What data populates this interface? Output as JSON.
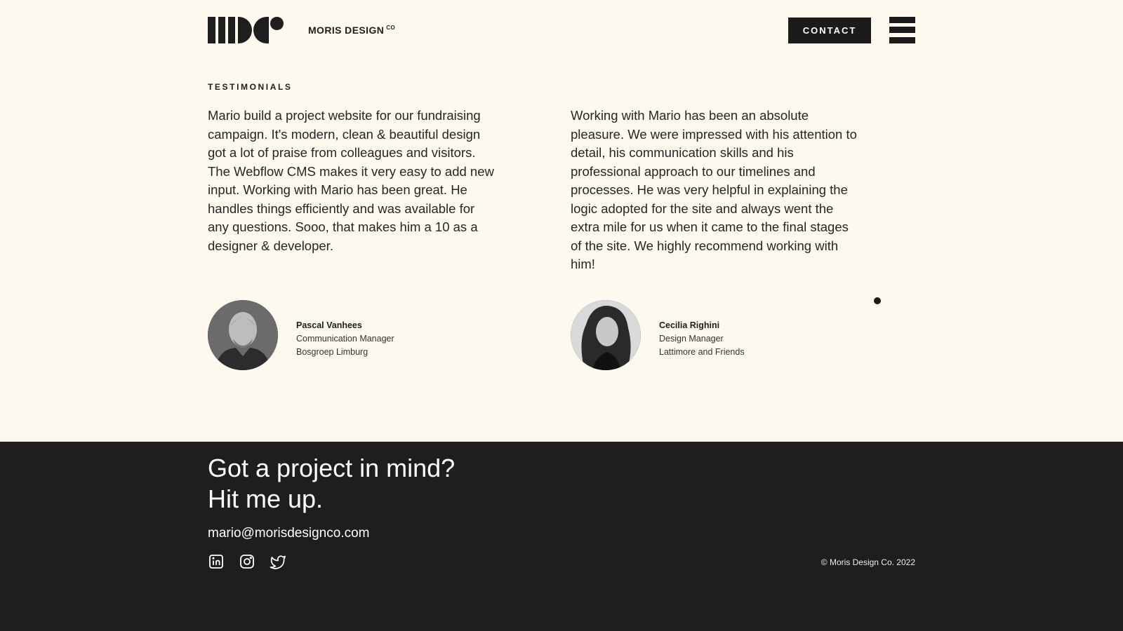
{
  "header": {
    "brand": "MORIS DESIGN",
    "brand_suffix": "CO",
    "contact_label": "CONTACT"
  },
  "testimonials": {
    "section_label": "TESTIMONIALS",
    "items": [
      {
        "quote": "Mario build a project website for our fundraising campaign. It's modern, clean & beautiful design got a lot of praise from colleagues and visitors. The Webflow CMS makes it very easy to add new input. Working with Mario has been great. He handles things efficiently and was available for any questions. Sooo, that makes him a 10 as a designer & developer.",
        "name": "Pascal Vanhees",
        "role": "Communication Manager",
        "company": "Bosgroep Limburg"
      },
      {
        "quote": "Working with Mario has been an absolute pleasure. We were impressed with his attention to detail, his communication skills and his professional approach to our timelines and processes. He was very helpful in explaining the logic adopted for the site and always went the extra mile for us when it came to the final stages of the site. We highly recommend working with him!",
        "name": "Cecilia Righini",
        "role": "Design Manager",
        "company": "Lattimore and Friends"
      }
    ]
  },
  "footer": {
    "cta_line1": "Got a project in mind?",
    "cta_line2": "Hit me up.",
    "email": "mario@morisdesignco.com",
    "socials": [
      "linkedin-icon",
      "instagram-icon",
      "twitter-icon"
    ],
    "copyright": "© Moris Design Co. 2022"
  },
  "colors": {
    "background": "#fdf9ef",
    "ink": "#1e1e1e",
    "footer_bg": "#1f1d1d"
  }
}
